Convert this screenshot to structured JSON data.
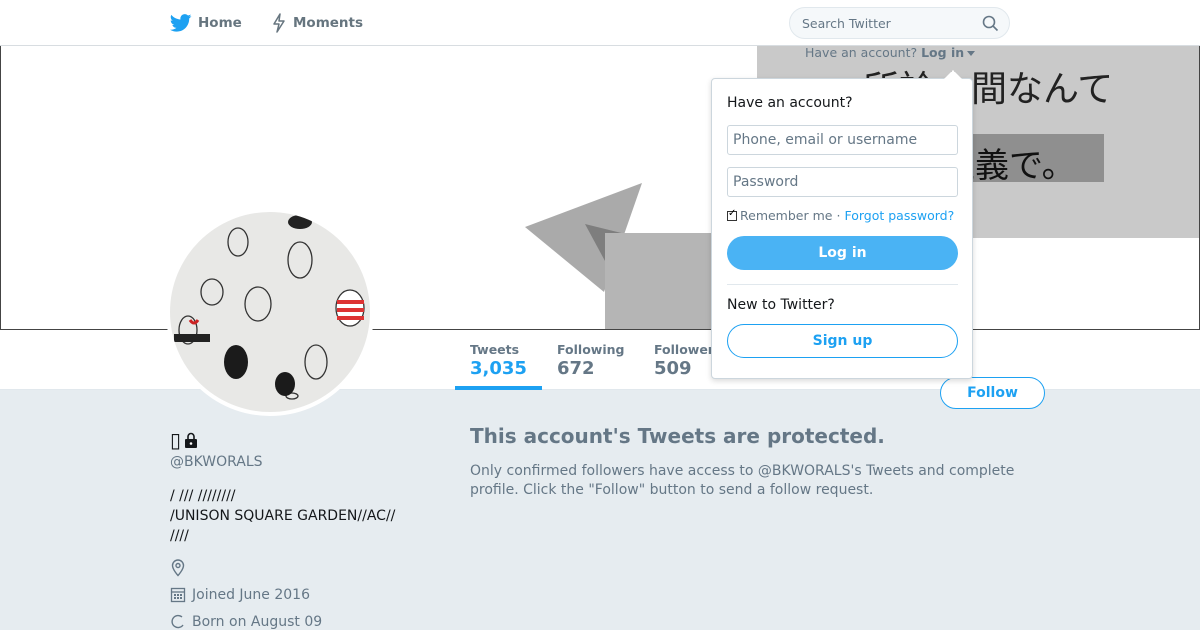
{
  "nav": {
    "home_label": "Home",
    "moments_label": "Moments",
    "search_placeholder": "Search Twitter"
  },
  "banner": {
    "line1": "所詮人間なんて",
    "line2": "主義で。"
  },
  "stats": {
    "tweets_label": "Tweets",
    "tweets_value": "3,035",
    "following_label": "Following",
    "following_value": "672",
    "followers_label": "Followers",
    "followers_value": "509"
  },
  "follow_button": "Follow",
  "profile": {
    "name": "▯",
    "handle": "@BKWORALS",
    "bio_lines": [
      "/ /// ////////",
      "/UNISON SQUARE GARDEN//AC//",
      "////"
    ],
    "joined": "Joined June 2016",
    "born": "Born on August 09"
  },
  "protected": {
    "title": "This account's Tweets are protected.",
    "text": "Only confirmed followers have access to @BKWORALS's Tweets and complete profile. Click the \"Follow\" button to send a follow request."
  },
  "login": {
    "prompt": "Have an account?",
    "link": "Log in",
    "title": "Have an account?",
    "username_placeholder": "Phone, email or username",
    "password_placeholder": "Password",
    "remember": "Remember me",
    "separator": "·",
    "forgot": "Forgot password?",
    "login_button": "Log in",
    "new_to": "New to Twitter?",
    "signup_button": "Sign up"
  },
  "colors": {
    "brand": "#1da1f2",
    "background": "#e6ecf0"
  }
}
